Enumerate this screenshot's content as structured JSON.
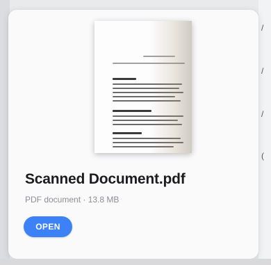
{
  "file": {
    "name": "Scanned Document.pdf",
    "details": "PDF document · 13.8 MB"
  },
  "actions": {
    "open_label": "OPEN"
  },
  "colors": {
    "accent": "#3c82f6",
    "title": "#1c1c1e",
    "subtitle": "#8e8e93",
    "card": "#fafafb"
  },
  "icons": [
    "document-thumbnail"
  ]
}
